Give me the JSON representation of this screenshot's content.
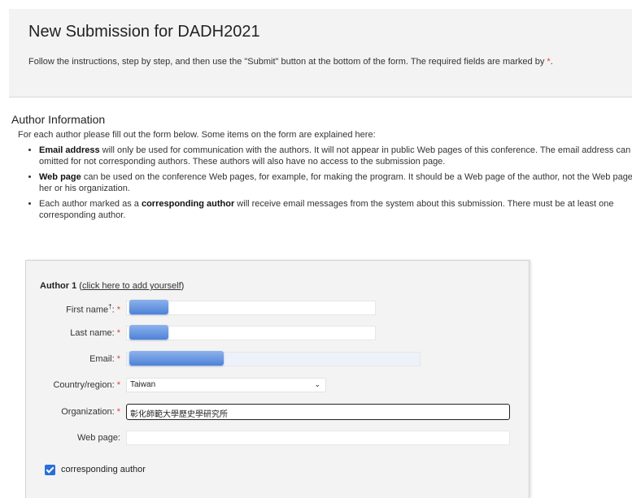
{
  "header": {
    "title": "New Submission for DADH2021",
    "instructions": "Follow the instructions, step by step, and then use the \"Submit\" button at the bottom of the form. The required fields are marked by",
    "required_marker": "*",
    "instructions_end": "."
  },
  "author_info": {
    "title": "Author Information",
    "intro": "For each author please fill out the form below. Some items on the form are explained here:",
    "bullets": [
      {
        "bold": "Email address",
        "text": " will only be used for communication with the authors. It will not appear in public Web pages of this conference. The email address can be omitted for not corresponding authors. These authors will also have no access to the submission page."
      },
      {
        "bold": "Web page",
        "text": " can be used on the conference Web pages, for example, for making the program. It should be a Web page of the author, not the Web page of her or his organization."
      },
      {
        "pre": "Each author marked as a ",
        "bold": "corresponding author",
        "text": " will receive email messages from the system about this submission. There must be at least one corresponding author."
      }
    ]
  },
  "author_form": {
    "heading": "Author 1",
    "add_yourself_prefix": "(",
    "add_yourself_link": "click here to add yourself",
    "add_yourself_suffix": ")",
    "first_name_label": "First name",
    "first_name_sup": "†",
    "first_name_colon": ":",
    "last_name_label": "Last name:",
    "email_label": "Email:",
    "country_label": "Country/region:",
    "country_value": "Taiwan",
    "organization_label": "Organization:",
    "organization_value": "彰化師範大學歷史學研究所",
    "web_page_label": "Web page:",
    "web_page_value": "",
    "required_marker": "*",
    "corresponding_label": "corresponding author",
    "corresponding_checked": true
  },
  "colors": {
    "required": "#e0413a",
    "accent": "#2a6fd6",
    "blur": "#4d82d8"
  }
}
